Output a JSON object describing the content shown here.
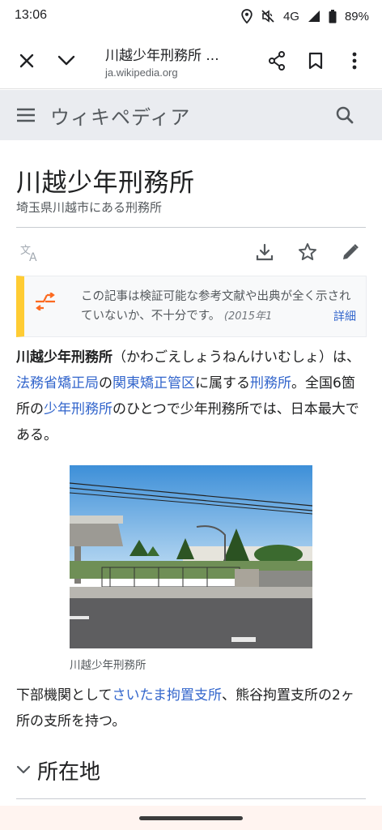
{
  "status_bar": {
    "time": "13:06",
    "network": "4G",
    "battery": "89%",
    "icons": [
      "location-icon",
      "mute-icon",
      "signal-icon",
      "battery-icon"
    ]
  },
  "toolbar": {
    "title": "川越少年刑務所 ...",
    "url": "ja.wikipedia.org",
    "icons": [
      "close-icon",
      "chevron-down-icon",
      "share-icon",
      "bookmark-icon",
      "more-vert-icon"
    ]
  },
  "wiki_header": {
    "logo": "ウィキペディア",
    "icons": [
      "menu-icon",
      "search-icon"
    ]
  },
  "article": {
    "title": "川越少年刑務所",
    "description": "埼玉県川越市にある刑務所",
    "actions": [
      "language-icon",
      "download-icon",
      "star-icon",
      "edit-icon"
    ],
    "notice": {
      "text": "この記事は検証可能な参考文献や出典が全く示されていないか、不十分です。",
      "date": "(2015年1",
      "more": "詳細"
    },
    "intro": {
      "bold": "川越少年刑務所",
      "reading": "（かわごえしょうねんけいむしょ）は、",
      "link1": "法務省矯正局",
      "t1": "の",
      "link2": "関東矯正管区",
      "t2": "に属する",
      "link3": "刑務所",
      "t3": "。全国6箇所の",
      "link4": "少年刑務所",
      "t4": "のひとつで少年刑務所では、日本最大である。"
    },
    "image_caption": "川越少年刑務所",
    "branch": {
      "t1": "下部機関として",
      "link1": "さいたま拘置支所",
      "t2": "、熊谷拘置支所の2ヶ所の支所を持つ。"
    },
    "section": {
      "title": "所在地",
      "icon": "chevron-down-icon"
    }
  }
}
